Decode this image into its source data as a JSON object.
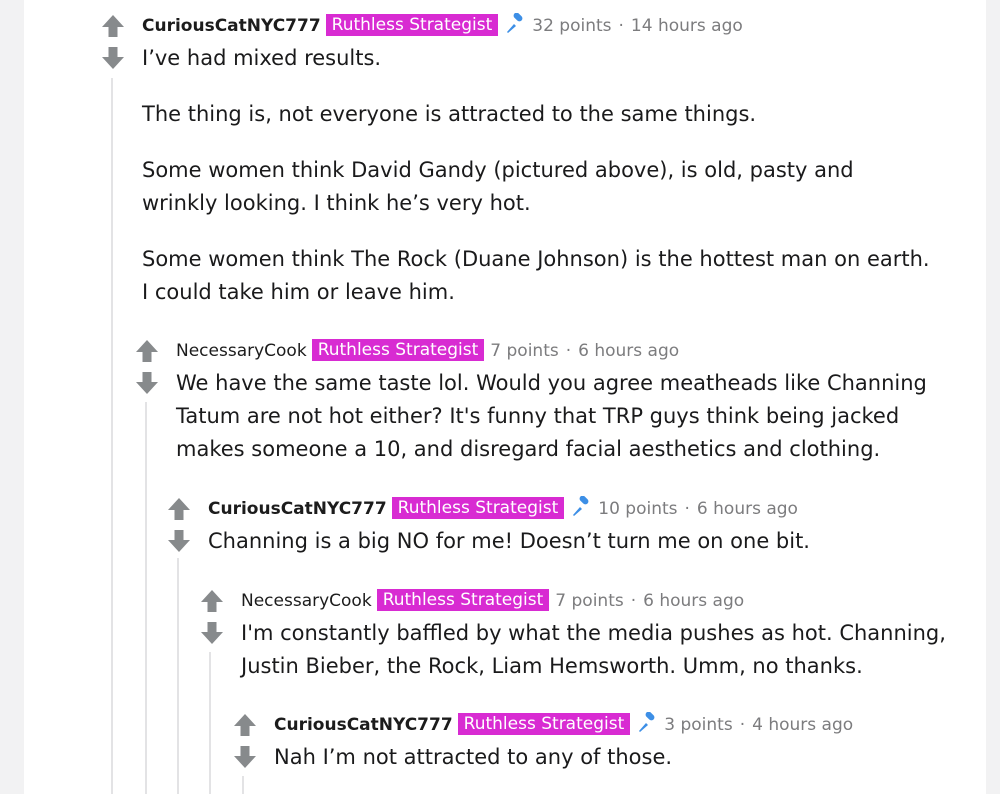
{
  "comments": [
    {
      "author": "CuriousCatNYC777",
      "flair": "Ruthless Strategist",
      "points": "32 points",
      "time": "14 hours ago",
      "paragraphs": [
        "I’ve had mixed results.",
        "The thing is, not everyone is attracted to the same things.",
        "Some women think David Gandy (pictured above), is old, pasty and wrinkly looking. I think he’s very hot.",
        "Some women think The Rock (Duane Johnson) is the hottest man on earth. I could take him or leave him."
      ]
    },
    {
      "author": "NecessaryCook",
      "flair": "Ruthless Strategist",
      "points": "7 points",
      "time": "6 hours ago",
      "paragraphs": [
        "We have the same taste lol. Would you agree meatheads like Channing Tatum are not hot either? It's funny that TRP guys think being jacked makes someone a 10, and disregard facial aesthetics and clothing."
      ]
    },
    {
      "author": "CuriousCatNYC777",
      "flair": "Ruthless Strategist",
      "points": "10 points",
      "time": "6 hours ago",
      "paragraphs": [
        "Channing is a big NO for me! Doesn’t turn me on one bit."
      ]
    },
    {
      "author": "NecessaryCook",
      "flair": "Ruthless Strategist",
      "points": "7 points",
      "time": "6 hours ago",
      "paragraphs": [
        "I'm constantly baffled by what the media pushes as hot. Channing, Justin Bieber, the Rock, Liam Hemsworth. Umm, no thanks."
      ]
    },
    {
      "author": "CuriousCatNYC777",
      "flair": "Ruthless Strategist",
      "points": "3 points",
      "time": "4 hours ago",
      "paragraphs": [
        "Nah I’m not attracted to any of those."
      ]
    }
  ],
  "separator": "·",
  "colors": {
    "flair": "#d82bd2",
    "meta": "#7c7c7e",
    "vote": "#878a8c",
    "pin": "#3d8fe6"
  },
  "icons": {
    "upvote": "arrow-up-icon",
    "downvote": "arrow-down-icon",
    "verified": "microphone-icon"
  }
}
